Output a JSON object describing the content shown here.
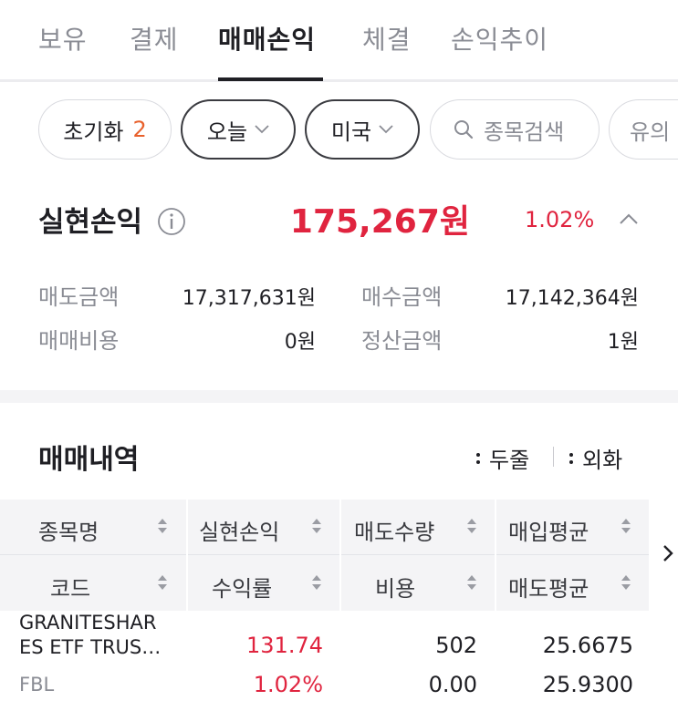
{
  "tabs": [
    {
      "label": "보유"
    },
    {
      "label": "결제"
    },
    {
      "label": "매매손익"
    },
    {
      "label": "체결"
    },
    {
      "label": "손익추이"
    }
  ],
  "filters": {
    "reset_label": "초기화",
    "reset_count": "2",
    "period_label": "오늘",
    "market_label": "미국",
    "search_placeholder": "종목검색",
    "more_label": "유의"
  },
  "realized": {
    "title": "실현손익",
    "amount": "175,267원",
    "rate": "1.02%",
    "items": [
      {
        "label": "매도금액",
        "value": "17,317,631원"
      },
      {
        "label": "매수금액",
        "value": "17,142,364원"
      },
      {
        "label": "매매비용",
        "value": "0원"
      },
      {
        "label": "정산금액",
        "value": "1원"
      }
    ]
  },
  "history": {
    "title": "매매내역",
    "unit_options": [
      "두줄",
      "외화"
    ],
    "headers_top": [
      "종목명",
      "실현손익",
      "매도수량",
      "매입평균"
    ],
    "headers_bottom": [
      "코드",
      "수익률",
      "비용",
      "매도평균"
    ],
    "rows": [
      {
        "name_line1": "GRANITESHAR",
        "name_line2": "ES ETF TRUS…",
        "code": "FBL",
        "realized": "131.74",
        "rate": "1.02%",
        "sell_qty": "502",
        "cost": "0.00",
        "buy_avg": "25.6675",
        "sell_avg": "25.9300"
      }
    ]
  },
  "colors": {
    "positive": "#e0243f",
    "accent_count": "#e8612c",
    "muted": "#8a8c94"
  }
}
